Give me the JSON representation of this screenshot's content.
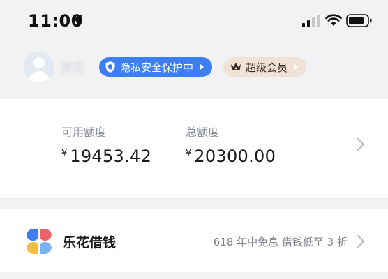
{
  "status_bar": {
    "time": "11:00",
    "icons": [
      "location-arrow-icon",
      "signal-icon",
      "wifi-icon",
      "battery-icon"
    ]
  },
  "profile": {
    "username": "赛青",
    "avatar": "avatar-placeholder",
    "privacy_badge": "隐私安全保护中",
    "vip_badge": "超级会员"
  },
  "quota": {
    "available_label": "可用额度",
    "available_currency": "¥",
    "available_value": "19453.42",
    "total_label": "总额度",
    "total_currency": "¥",
    "total_value": "20300.00"
  },
  "loan": {
    "title": "乐花借钱",
    "promo": "618 年中免息 借钱低至 3 折"
  },
  "colors": {
    "privacy_pill": "#3b7ff2",
    "vip_pill": "#f0e2d7",
    "petal_red": "#f0626b",
    "petal_blue_light": "#7ab2f4",
    "petal_blue": "#3a7ef0",
    "petal_yellow": "#f6bd3f"
  }
}
